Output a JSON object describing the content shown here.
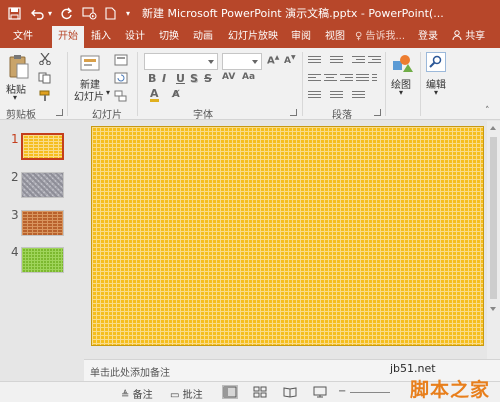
{
  "titlebar": {
    "title": "新建 Microsoft PowerPoint 演示文稿.pptx - PowerPoint(..."
  },
  "tabs": [
    {
      "label": "文件",
      "active": false
    },
    {
      "label": "开始",
      "active": true
    },
    {
      "label": "插入",
      "active": false
    },
    {
      "label": "设计",
      "active": false
    },
    {
      "label": "切换",
      "active": false
    },
    {
      "label": "动画",
      "active": false
    },
    {
      "label": "幻灯片放映",
      "active": false
    },
    {
      "label": "审阅",
      "active": false
    },
    {
      "label": "视图",
      "active": false
    }
  ],
  "tell_me": "♀ 告诉我...",
  "login": "登录",
  "share": "共享",
  "ribbon": {
    "clipboard": {
      "paste_label": "粘贴",
      "group_label": "剪贴板"
    },
    "slides": {
      "new_slide_line1": "新建",
      "new_slide_line2": "幻灯片",
      "group_label": "幻灯片"
    },
    "font": {
      "group_label": "字体",
      "bold": "B",
      "italic": "I",
      "underline": "U",
      "strike": "S",
      "shadow": "S"
    },
    "paragraph": {
      "group_label": "段落"
    },
    "drawing": {
      "label": "绘图"
    },
    "editing": {
      "label": "编辑"
    }
  },
  "thumbnails": [
    {
      "number": "1",
      "active": true,
      "pattern": "yellow-brick"
    },
    {
      "number": "2",
      "active": false,
      "pattern": "gray-weave"
    },
    {
      "number": "3",
      "active": false,
      "pattern": "brown-brick"
    },
    {
      "number": "4",
      "active": false,
      "pattern": "green-grid"
    }
  ],
  "notes_placeholder": "单击此处添加备注",
  "statusbar": {
    "notes": "备注",
    "comments": "批注"
  },
  "watermark": {
    "url": "jb51.net",
    "name": "脚本之家"
  },
  "colors": {
    "accent": "#b7472a",
    "selected": "#c43e1c",
    "slide_fill": "#f5be1e"
  }
}
